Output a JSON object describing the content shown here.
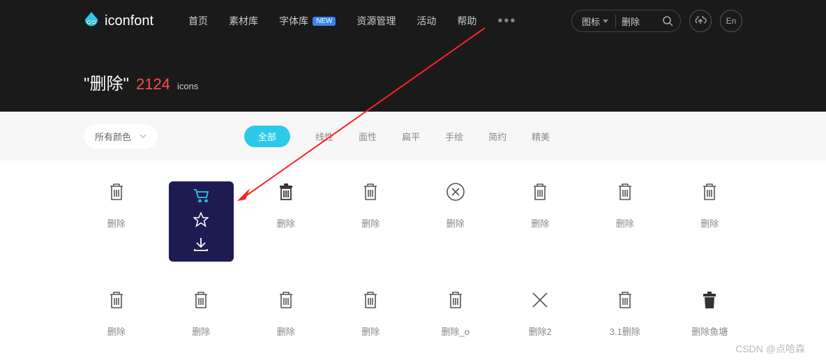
{
  "logo_text": "iconfont",
  "nav": [
    "首页",
    "素材库",
    "字体库",
    "资源管理",
    "活动",
    "帮助"
  ],
  "new_badge": "NEW",
  "search": {
    "type": "图标",
    "value": "删除"
  },
  "lang": "En",
  "title": {
    "term": "\"删除\"",
    "count": "2124",
    "word": "icons"
  },
  "color_filter": "所有颜色",
  "filter_tabs": [
    "全部",
    "线性",
    "面性",
    "扁平",
    "手绘",
    "简约",
    "精美"
  ],
  "row1": [
    {
      "label": "删除",
      "type": "trash-outline"
    },
    {
      "label": "",
      "type": "hovered"
    },
    {
      "label": "删除",
      "type": "trash-fill-lid"
    },
    {
      "label": "删除",
      "type": "trash-outline"
    },
    {
      "label": "删除",
      "type": "circle-x"
    },
    {
      "label": "删除",
      "type": "trash-outline"
    },
    {
      "label": "删除",
      "type": "trash-outline"
    },
    {
      "label": "删除",
      "type": "trash-outline"
    }
  ],
  "row2": [
    {
      "label": "删除",
      "type": "trash-outline"
    },
    {
      "label": "删除",
      "type": "trash-outline"
    },
    {
      "label": "删除",
      "type": "trash-outline"
    },
    {
      "label": "删除",
      "type": "trash-outline"
    },
    {
      "label": "删除_o",
      "type": "trash-outline"
    },
    {
      "label": "删除2",
      "type": "x-plain"
    },
    {
      "label": "3.1删除",
      "type": "trash-outline"
    },
    {
      "label": "删除鱼塘",
      "type": "trash-fill"
    }
  ],
  "watermark": "CSDN @点哈森"
}
